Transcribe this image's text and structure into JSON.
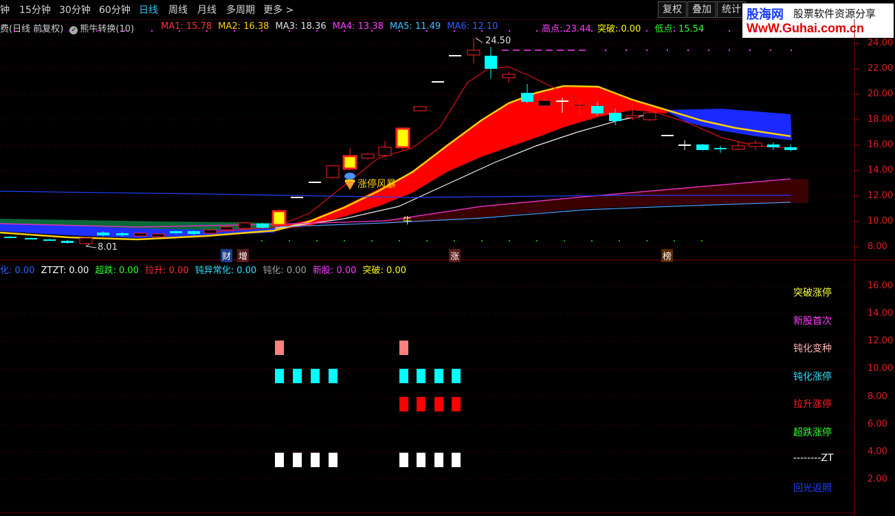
{
  "toolbar": {
    "periods": [
      "钟",
      "15分钟",
      "30分钟",
      "60分钟",
      "日线",
      "周线",
      "月线",
      "多周期",
      "更多 >"
    ],
    "active_period": "日线",
    "buttons": [
      "复权",
      "叠加",
      "统计"
    ]
  },
  "logo": {
    "line1": "股海网",
    "line2": "股票软件资源分享",
    "line3": "WwW.Guhai.com.cn"
  },
  "main_legend": {
    "prefix": "费(日线 前复权)",
    "indicator": "熊牛转换(10)",
    "items": [
      {
        "label": "MA1: 15.78",
        "color": "#ff3030"
      },
      {
        "label": "MA2: 16.38",
        "color": "#ffd000"
      },
      {
        "label": "MA3: 18.36",
        "color": "#e0e0e0"
      },
      {
        "label": "MA4: 13.38",
        "color": "#ff40ff"
      },
      {
        "label": "MA5: 11.49",
        "color": "#40c0ff"
      },
      {
        "label": "MA6: 12.10",
        "color": "#3060ff"
      },
      {
        "label": "高点: 23.44",
        "color": "#ff40ff"
      },
      {
        "label": "突破: 0.00",
        "color": "#ffff00"
      },
      {
        "label": "低点: 15.54",
        "color": "#30ff30"
      }
    ]
  },
  "sub_legend": {
    "items": [
      {
        "label": "化: 0.00",
        "color": "#3060ff"
      },
      {
        "label": "ZTZT: 0.00",
        "color": "#ffffff"
      },
      {
        "label": "超跌: 0.00",
        "color": "#30ff30"
      },
      {
        "label": "拉升: 0.00",
        "color": "#ff3030"
      },
      {
        "label": "钝异常化: 0.00",
        "color": "#30e0ff"
      },
      {
        "label": "钝化: 0.00",
        "color": "#a0a0a0"
      },
      {
        "label": "新股: 0.00",
        "color": "#ff40ff"
      },
      {
        "label": "突破: 0.00",
        "color": "#ffff00"
      }
    ]
  },
  "main_axis": [
    "24.00",
    "22.00",
    "20.00",
    "18.00",
    "16.00",
    "14.00",
    "12.00",
    "10.00",
    "8.00"
  ],
  "sub_axis": [
    "16.00",
    "14.00",
    "12.00",
    "10.00",
    "8.00",
    "6.00",
    "4.00",
    "2.00"
  ],
  "annotations": {
    "high_label": "24.50",
    "low_label": "8.01",
    "signal_text": "涨停风暴",
    "bull_mark": "牛",
    "badges": [
      "财",
      "增",
      "涨",
      "榜"
    ]
  },
  "sub_signals": [
    {
      "label": "突破涨停",
      "color": "#ffff40"
    },
    {
      "label": "新股首次",
      "color": "#ff40ff"
    },
    {
      "label": "钝化变种",
      "color": "#ffb0b0"
    },
    {
      "label": "钝化涨停",
      "color": "#30e0ff"
    },
    {
      "label": "拉升涨停",
      "color": "#ff2020"
    },
    {
      "label": "超跌涨停",
      "color": "#30ff30"
    },
    {
      "label": "--------ZT",
      "color": "#ffffff"
    },
    {
      "label": "回光返照",
      "color": "#2040ff"
    }
  ]
}
